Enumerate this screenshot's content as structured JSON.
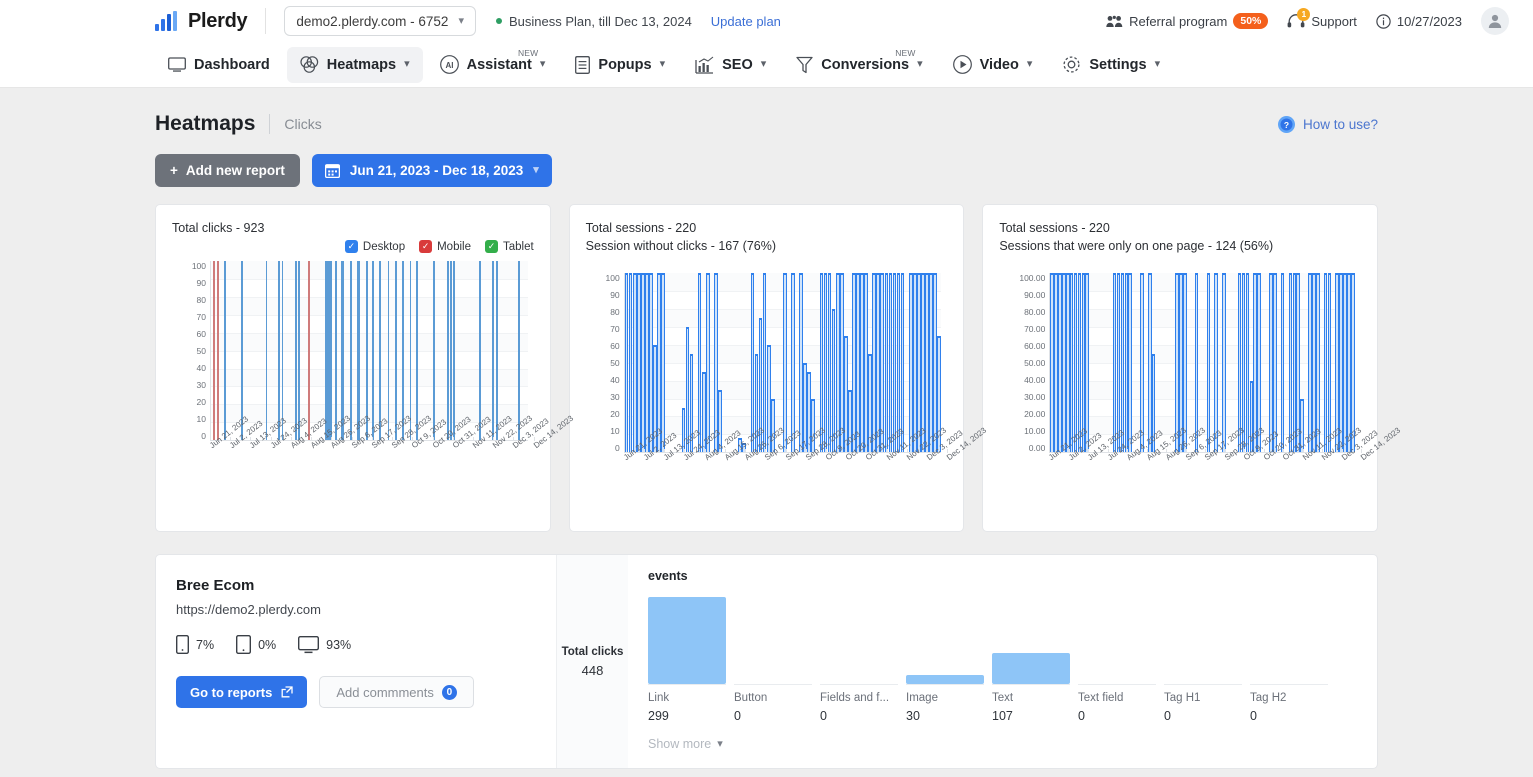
{
  "topbar": {
    "logo_text": "Plerdy",
    "site_selector": {
      "value": "demo2.plerdy.com - 6752"
    },
    "plan_text": "Business Plan, till Dec 13, 2024",
    "update_plan_label": "Update plan",
    "referral_label": "Referral program",
    "referral_badge": "50%",
    "support_label": "Support",
    "support_count": "1",
    "date_label": "10/27/2023"
  },
  "nav": {
    "items": [
      {
        "label": "Dashboard",
        "icon": "monitor-icon",
        "has_chevron": false,
        "new": false,
        "active": false
      },
      {
        "label": "Heatmaps",
        "icon": "venn-icon",
        "has_chevron": true,
        "new": false,
        "active": true
      },
      {
        "label": "Assistant",
        "icon": "ai-icon",
        "has_chevron": true,
        "new": true,
        "active": false
      },
      {
        "label": "Popups",
        "icon": "document-icon",
        "has_chevron": true,
        "new": false,
        "active": false
      },
      {
        "label": "SEO",
        "icon": "bar-chart-icon",
        "has_chevron": true,
        "new": false,
        "active": false
      },
      {
        "label": "Conversions",
        "icon": "funnel-icon",
        "has_chevron": true,
        "new": true,
        "active": false
      },
      {
        "label": "Video",
        "icon": "play-icon",
        "has_chevron": true,
        "new": false,
        "active": false
      },
      {
        "label": "Settings",
        "icon": "gear-icon",
        "has_chevron": true,
        "new": false,
        "active": false
      }
    ],
    "new_tag": "NEW"
  },
  "page": {
    "title": "Heatmaps",
    "subtitle": "Clicks",
    "how_to_use": "How to use?",
    "add_report_label": "Add new report",
    "date_range_label": "Jun 21, 2023 - Dec 18, 2023"
  },
  "legend": [
    {
      "label": "Desktop",
      "color": "#2f80ed",
      "checked": true
    },
    {
      "label": "Mobile",
      "color": "#d93b3b",
      "checked": true
    },
    {
      "label": "Tablet",
      "color": "#33ae4a",
      "checked": true
    }
  ],
  "chart_data": [
    {
      "type": "bar",
      "title": "Total clicks - 923",
      "title_metric": "Total clicks",
      "title_value": "923",
      "xlabel": "",
      "ylabel": "",
      "ylim": [
        0,
        100
      ],
      "yticks": [
        "100",
        "90",
        "80",
        "70",
        "60",
        "50",
        "40",
        "30",
        "20",
        "10",
        "0"
      ],
      "grid": true,
      "legend_position": "top-right",
      "categories": [
        "Jun 21, 2023",
        "Jul 2, 2023",
        "Jul 13, 2023",
        "Jul 24, 2023",
        "Aug 4, 2023",
        "Aug 15, 2023",
        "Aug 26, 2023",
        "Sep 6, 2023",
        "Sep 17, 2023",
        "Sep 28, 2023",
        "Oct 9, 2023",
        "Oct 20, 2023",
        "Oct 31, 2023",
        "Nov 11, 2023",
        "Nov 22, 2023",
        "Dec 3, 2023",
        "Dec 14, 2023"
      ],
      "series": [
        {
          "name": "Desktop",
          "color": "#5b9bd5",
          "points": [
            {
              "x": 5.4,
              "y": 100,
              "w": 0.6
            },
            {
              "x": 12.2,
              "y": 100,
              "w": 0.6
            },
            {
              "x": 22.5,
              "y": 100,
              "w": 0.5
            },
            {
              "x": 27.5,
              "y": 100,
              "w": 0.5
            },
            {
              "x": 29.0,
              "y": 100,
              "w": 0.5
            },
            {
              "x": 34.3,
              "y": 100,
              "w": 0.8
            },
            {
              "x": 35.8,
              "y": 100,
              "w": 0.5
            },
            {
              "x": 47.0,
              "y": 100,
              "w": 2.2
            },
            {
              "x": 51.0,
              "y": 100,
              "w": 0.6
            },
            {
              "x": 53.5,
              "y": 100,
              "w": 0.8
            },
            {
              "x": 57.0,
              "y": 100,
              "w": 0.6
            },
            {
              "x": 60.0,
              "y": 100,
              "w": 1.0
            },
            {
              "x": 63.5,
              "y": 100,
              "w": 0.6
            },
            {
              "x": 66.0,
              "y": 100,
              "w": 0.6
            },
            {
              "x": 69.0,
              "y": 100,
              "w": 0.6
            },
            {
              "x": 72.5,
              "y": 100,
              "w": 0.6
            },
            {
              "x": 75.5,
              "y": 100,
              "w": 0.6
            },
            {
              "x": 78.5,
              "y": 100,
              "w": 0.6
            },
            {
              "x": 81.5,
              "y": 100,
              "w": 0.6
            },
            {
              "x": 84.0,
              "y": 100,
              "w": 0.6
            },
            {
              "x": 91.0,
              "y": 100,
              "w": 0.6
            },
            {
              "x": 97.0,
              "y": 100,
              "w": 0.5
            },
            {
              "x": 98.2,
              "y": 100,
              "w": 0.5
            },
            {
              "x": 99.4,
              "y": 100,
              "w": 0.5
            },
            {
              "x": 110.0,
              "y": 100,
              "w": 0.6
            },
            {
              "x": 115.5,
              "y": 100,
              "w": 0.5
            },
            {
              "x": 117.0,
              "y": 100,
              "w": 0.5
            },
            {
              "x": 126.0,
              "y": 100,
              "w": 0.6
            }
          ]
        },
        {
          "name": "Mobile",
          "color": "#cf7b7b",
          "points": [
            {
              "x": 1.0,
              "y": 100,
              "w": 0.6
            },
            {
              "x": 2.5,
              "y": 100,
              "w": 0.6
            },
            {
              "x": 40.0,
              "y": 100,
              "w": 0.6
            }
          ]
        }
      ]
    },
    {
      "type": "area",
      "title": "Total sessions - 220",
      "subtitle": "Session without clicks - 167 (76%)",
      "title_metric": "Total sessions",
      "title_value": "220",
      "sub_metric": "Session without clicks",
      "sub_value": "167 (76%)",
      "ylim": [
        0,
        100
      ],
      "yticks": [
        "100",
        "90",
        "80",
        "70",
        "60",
        "50",
        "40",
        "30",
        "20",
        "10",
        "0"
      ],
      "grid": true,
      "color": "#2f80ed",
      "fill": "#cfe3fa",
      "categories": [
        "Jun 21, 2023",
        "Jul 2, 2023",
        "Jul 13, 2023",
        "Jul 24, 2023",
        "Aug 4, 2023",
        "Aug 15, 2023",
        "Aug 26, 2023",
        "Sep 6, 2023",
        "Sep 17, 2023",
        "Sep 28, 2023",
        "Oct 9, 2023",
        "Oct 20, 2023",
        "Oct 31, 2023",
        "Nov 11, 2023",
        "Nov 22, 2023",
        "Dec 3, 2023",
        "Dec 14, 2023"
      ],
      "values": [
        100,
        100,
        100,
        100,
        100,
        100,
        100,
        60,
        100,
        100,
        0,
        0,
        0,
        0,
        25,
        70,
        55,
        0,
        100,
        45,
        100,
        0,
        100,
        35,
        0,
        0,
        0,
        0,
        8,
        5,
        0,
        100,
        55,
        75,
        100,
        60,
        30,
        0,
        0,
        100,
        0,
        100,
        0,
        100,
        50,
        45,
        30,
        0,
        100,
        100,
        100,
        80,
        100,
        100,
        65,
        35,
        100,
        100,
        100,
        100,
        55,
        100,
        100,
        100,
        100,
        100,
        100,
        100,
        100,
        0,
        100,
        100,
        100,
        100,
        100,
        100,
        100,
        65
      ]
    },
    {
      "type": "area",
      "title": "Total sessions - 220",
      "subtitle": "Sessions that were only on one page - 124 (56%)",
      "title_metric": "Total sessions",
      "title_value": "220",
      "sub_metric": "Sessions that were only on one page",
      "sub_value": "124 (56%)",
      "ylim": [
        0,
        100
      ],
      "yticks": [
        "100.00",
        "90.00",
        "80.00",
        "70.00",
        "60.00",
        "50.00",
        "40.00",
        "30.00",
        "20.00",
        "10.00",
        "0.00"
      ],
      "grid": true,
      "color": "#2f80ed",
      "fill": "#cfe3fa",
      "categories": [
        "Jun 21, 2023",
        "Jul 2, 2023",
        "Jul 13, 2023",
        "Jul 24, 2023",
        "Aug 4, 2023",
        "Aug 15, 2023",
        "Aug 26, 2023",
        "Sep 6, 2023",
        "Sep 17, 2023",
        "Sep 28, 2023",
        "Oct 9, 2023",
        "Oct 20, 2023",
        "Oct 31, 2023",
        "Nov 11, 2023",
        "Nov 22, 2023",
        "Dec 3, 2023",
        "Dec 14, 2023"
      ],
      "values": [
        100,
        100,
        100,
        100,
        100,
        100,
        100,
        100,
        100,
        100,
        0,
        0,
        0,
        0,
        0,
        0,
        100,
        100,
        100,
        100,
        100,
        0,
        0,
        100,
        0,
        100,
        55,
        0,
        0,
        0,
        0,
        0,
        100,
        100,
        100,
        0,
        0,
        100,
        0,
        0,
        100,
        0,
        100,
        0,
        100,
        0,
        0,
        0,
        100,
        100,
        100,
        40,
        100,
        100,
        0,
        0,
        100,
        100,
        0,
        100,
        0,
        100,
        100,
        100,
        30,
        0,
        100,
        100,
        100,
        0,
        100,
        100,
        0,
        100,
        100,
        100,
        100,
        100
      ]
    }
  ],
  "report": {
    "name": "Bree Ecom",
    "url": "https://demo2.plerdy.com",
    "devices": [
      {
        "icon": "mobile-icon",
        "value": "7%"
      },
      {
        "icon": "tablet-icon",
        "value": "0%"
      },
      {
        "icon": "desktop-icon",
        "value": "93%"
      }
    ],
    "go_to_reports_label": "Go to reports",
    "add_comments_label": "Add commments",
    "comments_count": "0",
    "total_clicks_label": "Total clicks",
    "total_clicks_value": "448",
    "events_title": "events",
    "events": [
      {
        "label": "Link",
        "value": "299"
      },
      {
        "label": "Button",
        "value": "0"
      },
      {
        "label": "Fields and f...",
        "value": "0"
      },
      {
        "label": "Image",
        "value": "30"
      },
      {
        "label": "Text",
        "value": "107"
      },
      {
        "label": "Text field",
        "value": "0"
      },
      {
        "label": "Tag H1",
        "value": "0"
      },
      {
        "label": "Tag H2",
        "value": "0"
      }
    ],
    "show_more_label": "Show more"
  }
}
